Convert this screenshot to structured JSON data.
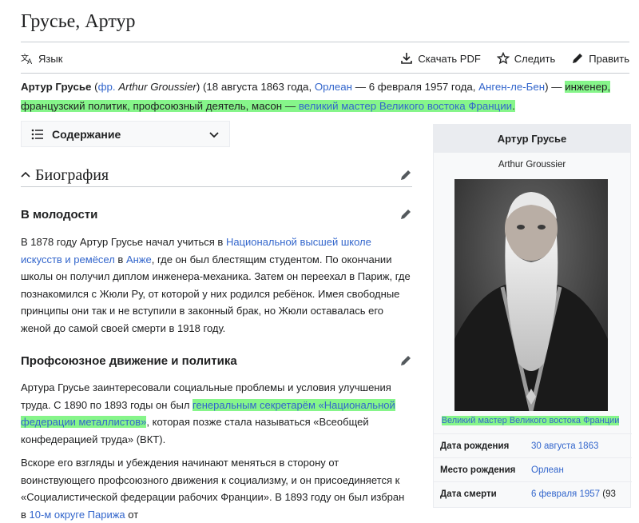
{
  "title": "Грусье, Артур",
  "toolbar": {
    "lang": "Язык",
    "pdf": "Скачать PDF",
    "watch": "Следить",
    "edit": "Править"
  },
  "lead": {
    "name": "Артур Грусье",
    "paren_open": " (",
    "fr_label": "фр.",
    "fr_name": "Arthur Groussier",
    "born_text": ") (18 августа 1863 года, ",
    "born_place": "Орлеан",
    "died_text": " — 6 февраля 1957 года, ",
    "died_place": "Анген-ле-Бен",
    "close": ") — ",
    "hl_text": "инженер, французский политик, профсоюзный деятель, масон — ",
    "hl_link": "великий мастер Великого востока Франции",
    "end": "."
  },
  "toc": {
    "label": "Содержание"
  },
  "sections": {
    "biography": "Биография",
    "youth": "В молодости",
    "union": "Профсоюзное движение и политика"
  },
  "p1": {
    "t1": "В 1878 году Артур Грусье начал учиться в ",
    "l1": "Национальной высшей школе искусств и ремёсел",
    "t2": " в ",
    "l2": "Анже",
    "t3": ", где он был блестящим студентом. По окончании школы он получил диплом инженера-механика. Затем он переехал в Париж, где познакомился с Жюли Ру, от которой у них родился ребёнок. Имея свободные принципы они так и не вступили в законный брак, но Жюли оставалась его женой до самой своей смерти в 1918 году."
  },
  "p2": {
    "t1": "Артура Грусье заинтересовали социальные проблемы и условия улучшения труда. С 1890 по 1893 годы он был ",
    "hl": "генеральным секретарём «Национальной федерации металлистов»",
    "t2": ", которая позже стала называться «Всеобщей конфедерацией труда» (ВКТ)."
  },
  "p3": {
    "t1": "Вскоре его взгляды и убеждения начинают меняться в сторону от воинствующего профсоюзного движения к социализму, и он присоединяется к «Социалистической федерации рабочих Франции». В 1893 году он был избран в ",
    "l1": "10-м округе Парижа",
    "t2": " от"
  },
  "infobox": {
    "title": "Артур Грусье",
    "subtitle": "Arthur Groussier",
    "caption": "Великий мастер Великого востока Франции",
    "rows": [
      {
        "label": "Дата рождения",
        "value": "30 августа 1863",
        "suffix": ""
      },
      {
        "label": "Место рождения",
        "value": "Орлеан",
        "suffix": ""
      },
      {
        "label": "Дата смерти",
        "value": "6 февраля 1957",
        "suffix": " (93"
      }
    ]
  },
  "colors": {
    "link": "#3366cc",
    "highlight": "#86f58a",
    "text": "#202122"
  }
}
